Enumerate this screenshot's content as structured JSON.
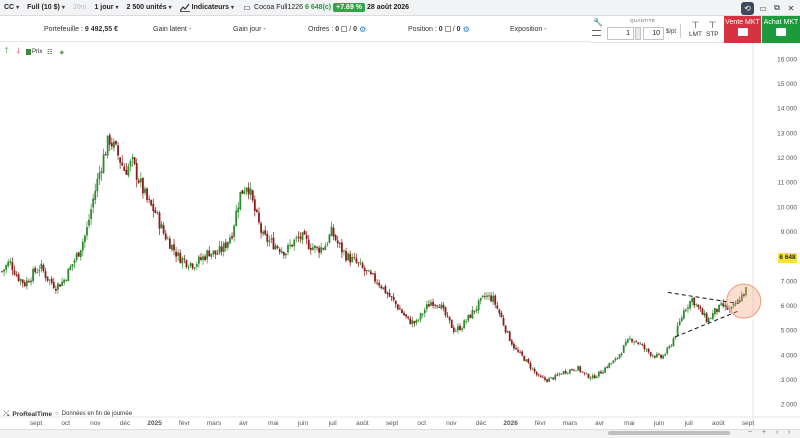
{
  "toolbar": {
    "symbol": "CC",
    "contract": "Full (10 $)",
    "timeframe_disabled": "20m",
    "period": "1 jour",
    "units": "2 500 unités",
    "indicators": "Indicateurs",
    "instrument": "Cocoa Full1226",
    "last_price": "6 648(c)",
    "change_pct": "+7.69 %",
    "date": "28 août 2026"
  },
  "infobar": {
    "portfolio_label": "Portefeuille :",
    "portfolio_value": "9 492,55 €",
    "latent_gain_label": "Gain latent",
    "day_gain_label": "Gain jour",
    "orders_label": "Ordres :",
    "orders_value": "0",
    "orders_value2": "0",
    "position_label": "Position :",
    "position_value": "0",
    "position_value2": "0",
    "exposure_label": "Exposition"
  },
  "order_panel": {
    "quantity_label": "QUANTITÉ",
    "quantity_value": "1",
    "size_value": "10",
    "unit_label": "$/pt",
    "lmt_label": "LMT",
    "stp_label": "STP",
    "sell_label": "Vente MKT",
    "buy_label": "Achat MKT"
  },
  "chart_tools": {
    "price_label": "Prix"
  },
  "footer": {
    "brand": "ProRealTime",
    "note": "Données en fin de journée"
  },
  "colors": {
    "up_candle": "#2e8b2e",
    "down_candle": "#8b1a1a",
    "sell": "#d63241",
    "buy": "#1d9a3b",
    "price_tag": "#f6e433"
  },
  "chart_data": {
    "type": "candlestick",
    "instrument": "Cocoa Full1226",
    "last_price": 6648,
    "y_ticks": [
      "16 000",
      "15 000",
      "14 000",
      "13 000",
      "12 000",
      "11 000",
      "10 000",
      "9 000",
      "8 000",
      "7 000",
      "6 000",
      "5 000",
      "4 000",
      "3 000",
      "2 000"
    ],
    "ylim": [
      1500,
      16500
    ],
    "x_ticks": [
      "sept",
      "oct",
      "nov",
      "déc",
      "2025",
      "févr",
      "mars",
      "avr",
      "mai",
      "juin",
      "juil",
      "août",
      "sept",
      "oct",
      "nov",
      "déc",
      "2026",
      "févr",
      "mars",
      "avr",
      "mai",
      "juin",
      "juil",
      "août",
      "sept"
    ],
    "close_series": [
      7400,
      7800,
      7200,
      6900,
      7300,
      7600,
      7100,
      6800,
      7000,
      7600,
      8200,
      9000,
      10500,
      11800,
      12800,
      12200,
      11500,
      11800,
      11000,
      10200,
      9800,
      9000,
      8500,
      8000,
      7800,
      7700,
      7900,
      8200,
      8100,
      8400,
      9000,
      10500,
      11000,
      9800,
      8800,
      8600,
      8400,
      8200,
      8600,
      8800,
      8500,
      8300,
      8400,
      9000,
      8400,
      8000,
      7800,
      7500,
      7200,
      7000,
      6600,
      6200,
      5800,
      5400,
      5300,
      5800,
      6200,
      6100,
      5500,
      5000,
      5200,
      5600,
      6000,
      6400,
      6300,
      5600,
      4800,
      4200,
      3900,
      3500,
      3100,
      3000,
      3100,
      3300,
      3400,
      3500,
      3200,
      3100,
      3300,
      3600,
      3800,
      4300,
      4700,
      4500,
      4200,
      4000,
      3900,
      4300,
      5000,
      5900,
      6300,
      5800,
      5400,
      5800,
      6000,
      5800,
      6200,
      6648
    ],
    "annotations": [
      "symmetrical triangle (dashed lines)",
      "highlight circle at last price"
    ]
  }
}
